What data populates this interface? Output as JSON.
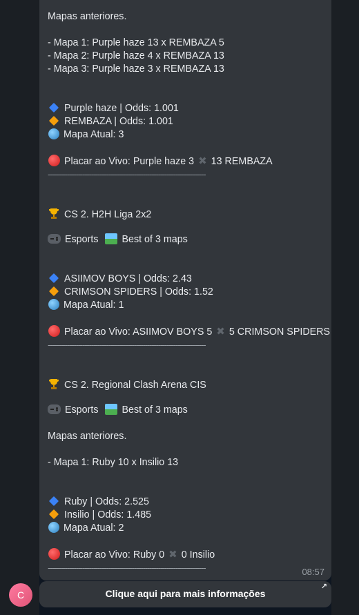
{
  "message": {
    "block1": {
      "previous_maps_title": "Mapas anteriores.",
      "maps": [
        "- Mapa 1: Purple haze 13 x REMBAZA 5",
        "- Mapa 2: Purple haze 4 x REMBAZA 13",
        "- Mapa 3: Purple haze 3 x REMBAZA 13"
      ],
      "team1": "Purple haze | Odds: 1.001",
      "team2": "REMBAZA | Odds: 1.001",
      "current_map": "Mapa Atual: 3",
      "live_score_left": "Placar ao Vivo: Purple haze 3",
      "live_score_right": "13 REMBAZA"
    },
    "separator": "-------------------------------------------------------------------------",
    "block2": {
      "league": "CS 2. H2H Liga 2x2",
      "sport": "Esports",
      "format": "Best of 3 maps",
      "team1": "ASIIMOV BOYS | Odds: 2.43",
      "team2": "CRIMSON SPIDERS | Odds: 1.52",
      "current_map": "Mapa Atual: 1",
      "live_score_left": "Placar ao Vivo: ASIIMOV BOYS 5",
      "live_score_right": "5 CRIMSON SPIDERS"
    },
    "block3": {
      "league": "CS 2. Regional Clash Arena CIS",
      "sport": "Esports",
      "format": "Best of 3 maps",
      "previous_maps_title": "Mapas anteriores.",
      "maps": [
        "- Mapa 1: Ruby 10 x Insilio 13"
      ],
      "team1": "Ruby | Odds: 2.525",
      "team2": "Insilio | Odds: 1.485",
      "current_map": "Mapa Atual: 2",
      "live_score_left": "Placar ao Vivo: Ruby 0",
      "live_score_right": "0 Insilio"
    },
    "time": "08:57"
  },
  "avatar_letter": "C",
  "inline_button": {
    "label": "Clique aqui para mais informações",
    "arrow": "↗"
  }
}
